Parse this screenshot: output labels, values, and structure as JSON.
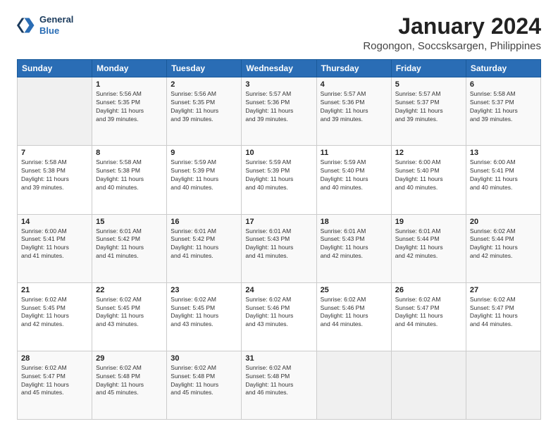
{
  "header": {
    "logo_line1": "General",
    "logo_line2": "Blue",
    "month": "January 2024",
    "location": "Rogongon, Soccsksargen, Philippines"
  },
  "days_of_week": [
    "Sunday",
    "Monday",
    "Tuesday",
    "Wednesday",
    "Thursday",
    "Friday",
    "Saturday"
  ],
  "weeks": [
    [
      {
        "day": "",
        "info": ""
      },
      {
        "day": "1",
        "info": "Sunrise: 5:56 AM\nSunset: 5:35 PM\nDaylight: 11 hours\nand 39 minutes."
      },
      {
        "day": "2",
        "info": "Sunrise: 5:56 AM\nSunset: 5:35 PM\nDaylight: 11 hours\nand 39 minutes."
      },
      {
        "day": "3",
        "info": "Sunrise: 5:57 AM\nSunset: 5:36 PM\nDaylight: 11 hours\nand 39 minutes."
      },
      {
        "day": "4",
        "info": "Sunrise: 5:57 AM\nSunset: 5:36 PM\nDaylight: 11 hours\nand 39 minutes."
      },
      {
        "day": "5",
        "info": "Sunrise: 5:57 AM\nSunset: 5:37 PM\nDaylight: 11 hours\nand 39 minutes."
      },
      {
        "day": "6",
        "info": "Sunrise: 5:58 AM\nSunset: 5:37 PM\nDaylight: 11 hours\nand 39 minutes."
      }
    ],
    [
      {
        "day": "7",
        "info": "Sunrise: 5:58 AM\nSunset: 5:38 PM\nDaylight: 11 hours\nand 39 minutes."
      },
      {
        "day": "8",
        "info": "Sunrise: 5:58 AM\nSunset: 5:38 PM\nDaylight: 11 hours\nand 40 minutes."
      },
      {
        "day": "9",
        "info": "Sunrise: 5:59 AM\nSunset: 5:39 PM\nDaylight: 11 hours\nand 40 minutes."
      },
      {
        "day": "10",
        "info": "Sunrise: 5:59 AM\nSunset: 5:39 PM\nDaylight: 11 hours\nand 40 minutes."
      },
      {
        "day": "11",
        "info": "Sunrise: 5:59 AM\nSunset: 5:40 PM\nDaylight: 11 hours\nand 40 minutes."
      },
      {
        "day": "12",
        "info": "Sunrise: 6:00 AM\nSunset: 5:40 PM\nDaylight: 11 hours\nand 40 minutes."
      },
      {
        "day": "13",
        "info": "Sunrise: 6:00 AM\nSunset: 5:41 PM\nDaylight: 11 hours\nand 40 minutes."
      }
    ],
    [
      {
        "day": "14",
        "info": "Sunrise: 6:00 AM\nSunset: 5:41 PM\nDaylight: 11 hours\nand 41 minutes."
      },
      {
        "day": "15",
        "info": "Sunrise: 6:01 AM\nSunset: 5:42 PM\nDaylight: 11 hours\nand 41 minutes."
      },
      {
        "day": "16",
        "info": "Sunrise: 6:01 AM\nSunset: 5:42 PM\nDaylight: 11 hours\nand 41 minutes."
      },
      {
        "day": "17",
        "info": "Sunrise: 6:01 AM\nSunset: 5:43 PM\nDaylight: 11 hours\nand 41 minutes."
      },
      {
        "day": "18",
        "info": "Sunrise: 6:01 AM\nSunset: 5:43 PM\nDaylight: 11 hours\nand 42 minutes."
      },
      {
        "day": "19",
        "info": "Sunrise: 6:01 AM\nSunset: 5:44 PM\nDaylight: 11 hours\nand 42 minutes."
      },
      {
        "day": "20",
        "info": "Sunrise: 6:02 AM\nSunset: 5:44 PM\nDaylight: 11 hours\nand 42 minutes."
      }
    ],
    [
      {
        "day": "21",
        "info": "Sunrise: 6:02 AM\nSunset: 5:45 PM\nDaylight: 11 hours\nand 42 minutes."
      },
      {
        "day": "22",
        "info": "Sunrise: 6:02 AM\nSunset: 5:45 PM\nDaylight: 11 hours\nand 43 minutes."
      },
      {
        "day": "23",
        "info": "Sunrise: 6:02 AM\nSunset: 5:45 PM\nDaylight: 11 hours\nand 43 minutes."
      },
      {
        "day": "24",
        "info": "Sunrise: 6:02 AM\nSunset: 5:46 PM\nDaylight: 11 hours\nand 43 minutes."
      },
      {
        "day": "25",
        "info": "Sunrise: 6:02 AM\nSunset: 5:46 PM\nDaylight: 11 hours\nand 44 minutes."
      },
      {
        "day": "26",
        "info": "Sunrise: 6:02 AM\nSunset: 5:47 PM\nDaylight: 11 hours\nand 44 minutes."
      },
      {
        "day": "27",
        "info": "Sunrise: 6:02 AM\nSunset: 5:47 PM\nDaylight: 11 hours\nand 44 minutes."
      }
    ],
    [
      {
        "day": "28",
        "info": "Sunrise: 6:02 AM\nSunset: 5:47 PM\nDaylight: 11 hours\nand 45 minutes."
      },
      {
        "day": "29",
        "info": "Sunrise: 6:02 AM\nSunset: 5:48 PM\nDaylight: 11 hours\nand 45 minutes."
      },
      {
        "day": "30",
        "info": "Sunrise: 6:02 AM\nSunset: 5:48 PM\nDaylight: 11 hours\nand 45 minutes."
      },
      {
        "day": "31",
        "info": "Sunrise: 6:02 AM\nSunset: 5:48 PM\nDaylight: 11 hours\nand 46 minutes."
      },
      {
        "day": "",
        "info": ""
      },
      {
        "day": "",
        "info": ""
      },
      {
        "day": "",
        "info": ""
      }
    ]
  ]
}
